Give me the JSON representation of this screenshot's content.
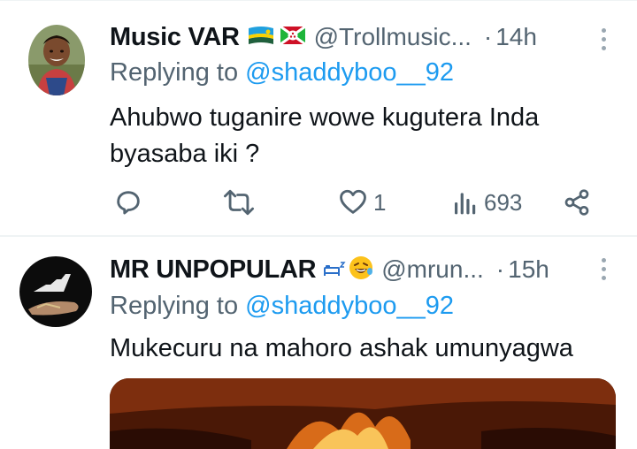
{
  "tweets": [
    {
      "name": "Music VAR",
      "handle": "@Trollmusic...",
      "time": "14h",
      "replying_prefix": "Replying to",
      "replying_to": "@shaddyboo__92",
      "text_lines": [
        "Ahubwo tuganire wowe kugutera Inda",
        "byasaba iki ?"
      ],
      "flags": [
        "rwanda-flag-icon",
        "burundi-flag-icon"
      ],
      "actions": {
        "reply": "",
        "retweet": "",
        "like": "1",
        "views": "693"
      }
    },
    {
      "name": "MR UNPOPULAR",
      "handle": "@mrun...",
      "time": "15h",
      "replying_prefix": "Replying to",
      "replying_to": "@shaddyboo__92",
      "text_lines": [
        "Mukecuru na mahoro ashak umunyagwa"
      ],
      "emojis": [
        "sleeping-bed-icon",
        "laughing-face-icon"
      ]
    }
  ],
  "colors": {
    "accent": "#1d9bf0",
    "muted": "#536471",
    "divider": "#eff3f4"
  },
  "dot_separator": "·"
}
